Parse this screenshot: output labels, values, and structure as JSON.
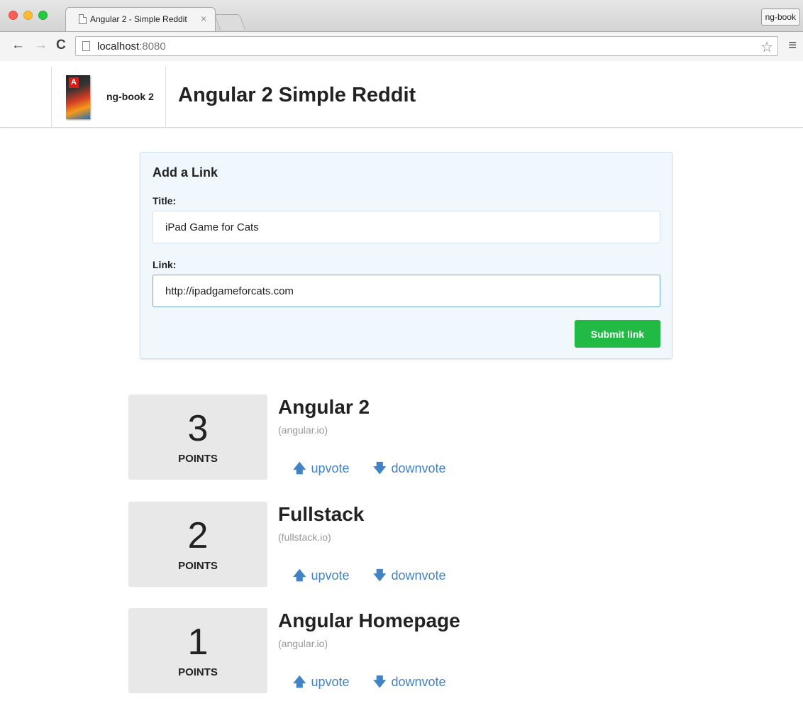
{
  "browser": {
    "tab_title": "Angular 2 - Simple Reddit",
    "tab_close": "×",
    "profile": "ng-book",
    "url_host": "localhost",
    "url_port": ":8080",
    "icons": {
      "back": "←",
      "forward": "→",
      "reload": "C",
      "star": "☆",
      "menu": "≡"
    }
  },
  "header": {
    "brand_name": "ng-book 2",
    "title": "Angular 2 Simple Reddit"
  },
  "form": {
    "heading": "Add a Link",
    "title_label": "Title:",
    "title_value": "iPad Game for Cats",
    "link_label": "Link:",
    "link_value": "http://ipadgameforcats.com",
    "submit_label": "Submit link"
  },
  "articles": [
    {
      "votes": "3",
      "points_label": "POINTS",
      "title": "Angular 2",
      "domain": "(angular.io)",
      "upvote": "upvote",
      "downvote": "downvote"
    },
    {
      "votes": "2",
      "points_label": "POINTS",
      "title": "Fullstack",
      "domain": "(fullstack.io)",
      "upvote": "upvote",
      "downvote": "downvote"
    },
    {
      "votes": "1",
      "points_label": "POINTS",
      "title": "Angular Homepage",
      "domain": "(angular.io)",
      "upvote": "upvote",
      "downvote": "downvote"
    }
  ],
  "icons": {
    "up_arrow": "🡅",
    "down_arrow": "🡇"
  },
  "colors": {
    "submit_green": "#21ba45",
    "link_blue": "#4183c4",
    "form_bg": "#f0f7fd",
    "vote_box_bg": "#e8e8e8"
  }
}
